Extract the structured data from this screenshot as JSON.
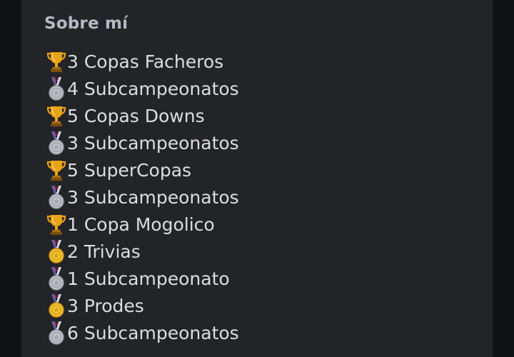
{
  "about": {
    "title": "Sobre mí",
    "items": [
      {
        "icon": "trophy-icon",
        "text": "3 Copas Facheros"
      },
      {
        "icon": "silver-medal-icon",
        "text": "4 Subcampeonatos"
      },
      {
        "icon": "trophy-icon",
        "text": "5 Copas Downs"
      },
      {
        "icon": "silver-medal-icon",
        "text": "3 Subcampeonatos"
      },
      {
        "icon": "trophy-icon",
        "text": "5 SuperCopas"
      },
      {
        "icon": "silver-medal-icon",
        "text": "3 Subcampeonatos"
      },
      {
        "icon": "trophy-icon",
        "text": "1 Copa Mogolico"
      },
      {
        "icon": "gold-medal-icon",
        "text": "2 Trivias"
      },
      {
        "icon": "silver-medal-icon",
        "text": "1 Subcampeonato"
      },
      {
        "icon": "gold-medal-icon",
        "text": "3 Prodes"
      },
      {
        "icon": "silver-medal-icon",
        "text": "6 Subcampeonatos"
      }
    ]
  },
  "colors": {
    "card_bg": "#232428",
    "title": "#b5bac1",
    "text": "#dbdee1",
    "trophy": "#e8a317",
    "silver": "#c0c4c8",
    "gold": "#f4c430"
  }
}
